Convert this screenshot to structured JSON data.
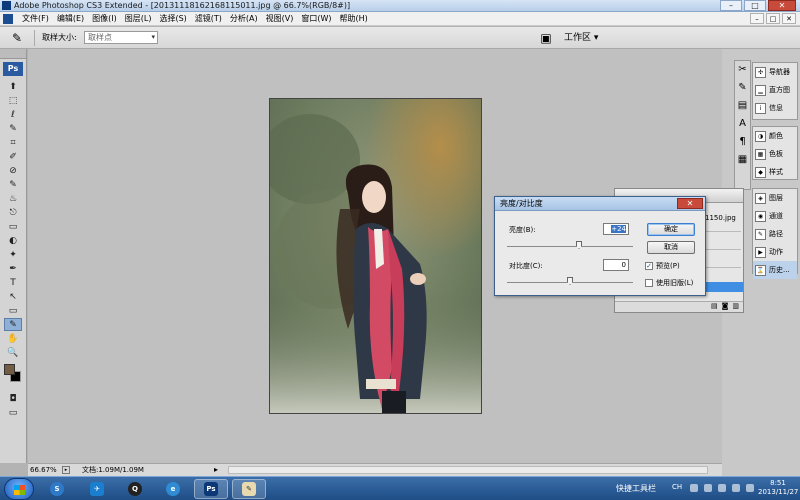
{
  "window": {
    "title": "Adobe Photoshop CS3 Extended - [20131118162168115011.jpg @ 66.7%(RGB/8#)]",
    "controls": [
      "–",
      "□",
      "✕"
    ]
  },
  "menu": {
    "items": [
      "文件(F)",
      "编辑(E)",
      "图像(I)",
      "图层(L)",
      "选择(S)",
      "滤镜(T)",
      "分析(A)",
      "视图(V)",
      "窗口(W)",
      "帮助(H)"
    ],
    "doc_controls": [
      "–",
      "□",
      "✕"
    ]
  },
  "options": {
    "sample_size_label": "取样大小:",
    "sample_size_value": "取样点",
    "workspace_label": "工作区 ▾"
  },
  "toolbox": {
    "badge": "Ps",
    "tools": [
      "⬆",
      "⬚",
      "ℓ",
      "✎",
      "⌗",
      "✐",
      "⊘",
      "✎",
      "♨",
      "⎋",
      "▭",
      "◐",
      "✦",
      "✒",
      "T",
      "↖",
      "▭",
      "✋",
      "🔍",
      "✋"
    ],
    "colors": {
      "foreground": "#725c44",
      "background": "#000000"
    }
  },
  "status": {
    "zoom": "66.67%",
    "doc_info": "文档:1.09M/1.09M"
  },
  "panels": {
    "group1": [
      "导航器",
      "直方图",
      "信息"
    ],
    "group2": [
      "颜色",
      "色板",
      "样式"
    ],
    "group3": [
      "图层",
      "通道",
      "路径",
      "动作",
      "历史..."
    ]
  },
  "history": {
    "snippet": "1150.jpg"
  },
  "dialog": {
    "title": "亮度/对比度",
    "brightness_label": "亮度(B):",
    "brightness_value": "+24",
    "contrast_label": "对比度(C):",
    "contrast_value": "0",
    "ok_label": "确定",
    "cancel_label": "取消",
    "preview_label": "预览(P)",
    "preview_checked": true,
    "legacy_label": "使用旧版(L)",
    "legacy_checked": false
  },
  "taskbar": {
    "quick_toolbar": "快捷工具栏",
    "lang": "CH",
    "time": "8:51",
    "date": "2013/11/27"
  }
}
